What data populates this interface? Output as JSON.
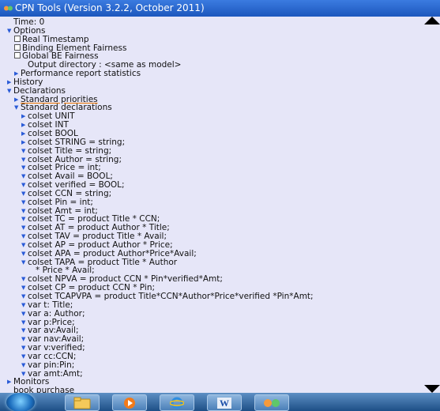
{
  "window": {
    "title": "CPN Tools (Version 3.2.2, October 2011)",
    "app_icon": "cpn-tools-icon"
  },
  "tree": [
    {
      "indent": 1,
      "toggle": "",
      "text": "Time: 0"
    },
    {
      "indent": 1,
      "toggle": "expanded",
      "text": "Options"
    },
    {
      "indent": 2,
      "toggle": "checkbox",
      "text": "Real Timestamp"
    },
    {
      "indent": 2,
      "toggle": "checkbox",
      "text": "Binding Element Fairness"
    },
    {
      "indent": 2,
      "toggle": "checkbox",
      "text": "Global BE Fairness"
    },
    {
      "indent": 3,
      "toggle": "",
      "text": "Output directory : <same as model>"
    },
    {
      "indent": 2,
      "toggle": "collapsed",
      "text": "Performance report statistics"
    },
    {
      "indent": 1,
      "toggle": "collapsed",
      "text": "History"
    },
    {
      "indent": 1,
      "toggle": "expanded",
      "text": "Declarations"
    },
    {
      "indent": 2,
      "toggle": "collapsed",
      "text": "Standard priorities",
      "highlight": true
    },
    {
      "indent": 2,
      "toggle": "expanded",
      "text": "Standard declarations"
    },
    {
      "indent": 3,
      "toggle": "collapsed",
      "text": "colset UNIT"
    },
    {
      "indent": 3,
      "toggle": "collapsed",
      "text": "colset INT"
    },
    {
      "indent": 3,
      "toggle": "collapsed",
      "text": "colset BOOL"
    },
    {
      "indent": 3,
      "toggle": "collapsed",
      "text": "colset STRING = string;"
    },
    {
      "indent": 3,
      "toggle": "expanded",
      "text": "colset Title = string;"
    },
    {
      "indent": 3,
      "toggle": "expanded",
      "text": "colset Author = string;"
    },
    {
      "indent": 3,
      "toggle": "expanded",
      "text": "colset Price = int;"
    },
    {
      "indent": 3,
      "toggle": "expanded",
      "text": "colset Avail = BOOL;"
    },
    {
      "indent": 3,
      "toggle": "expanded",
      "text": "colset verified = BOOL;"
    },
    {
      "indent": 3,
      "toggle": "expanded",
      "text": "colset CCN = string;"
    },
    {
      "indent": 3,
      "toggle": "expanded",
      "text": "colset Pin = int;"
    },
    {
      "indent": 3,
      "toggle": "expanded",
      "text": "colset Amt = int;"
    },
    {
      "indent": 3,
      "toggle": "expanded",
      "text": "colset TC = product Title * CCN;"
    },
    {
      "indent": 3,
      "toggle": "expanded",
      "text": "colset AT = product Author * Title;"
    },
    {
      "indent": 3,
      "toggle": "expanded",
      "text": "colset TAV = product Title * Avail;"
    },
    {
      "indent": 3,
      "toggle": "expanded",
      "text": "colset AP = product Author * Price;"
    },
    {
      "indent": 3,
      "toggle": "expanded",
      "text": "colset APA = product Author*Price*Avail;"
    },
    {
      "indent": 3,
      "toggle": "expanded",
      "text": "colset TAPA = product Title * Author"
    },
    {
      "indent": 4,
      "toggle": "",
      "text": "* Price * Avail;"
    },
    {
      "indent": 3,
      "toggle": "expanded",
      "text": "colset NPVA = product CCN * Pin*verified*Amt;"
    },
    {
      "indent": 3,
      "toggle": "expanded",
      "text": "colset CP = product CCN * Pin;"
    },
    {
      "indent": 3,
      "toggle": "expanded",
      "text": "colset TCAPVPA = product Title*CCN*Author*Price*verified *Pin*Amt;"
    },
    {
      "indent": 3,
      "toggle": "expanded",
      "text": "var t: Title;"
    },
    {
      "indent": 3,
      "toggle": "expanded",
      "text": "var a: Author;"
    },
    {
      "indent": 3,
      "toggle": "expanded",
      "text": "var p:Price;"
    },
    {
      "indent": 3,
      "toggle": "expanded",
      "text": "var av:Avail;"
    },
    {
      "indent": 3,
      "toggle": "expanded",
      "text": "var nav:Avail;"
    },
    {
      "indent": 3,
      "toggle": "expanded",
      "text": "var v:verified;"
    },
    {
      "indent": 3,
      "toggle": "expanded",
      "text": "var cc:CCN;"
    },
    {
      "indent": 3,
      "toggle": "expanded",
      "text": "var pin:Pin;"
    },
    {
      "indent": 3,
      "toggle": "expanded",
      "text": "var amt:Amt;"
    },
    {
      "indent": 1,
      "toggle": "collapsed",
      "text": "Monitors"
    },
    {
      "indent": 1,
      "toggle": "",
      "text": "book purchase",
      "highlight": true
    }
  ],
  "taskbar": {
    "items": [
      {
        "name": "explorer-icon"
      },
      {
        "name": "media-player-icon"
      },
      {
        "name": "internet-explorer-icon"
      },
      {
        "name": "word-icon",
        "label": "W"
      },
      {
        "name": "cpn-tools-icon"
      }
    ]
  }
}
